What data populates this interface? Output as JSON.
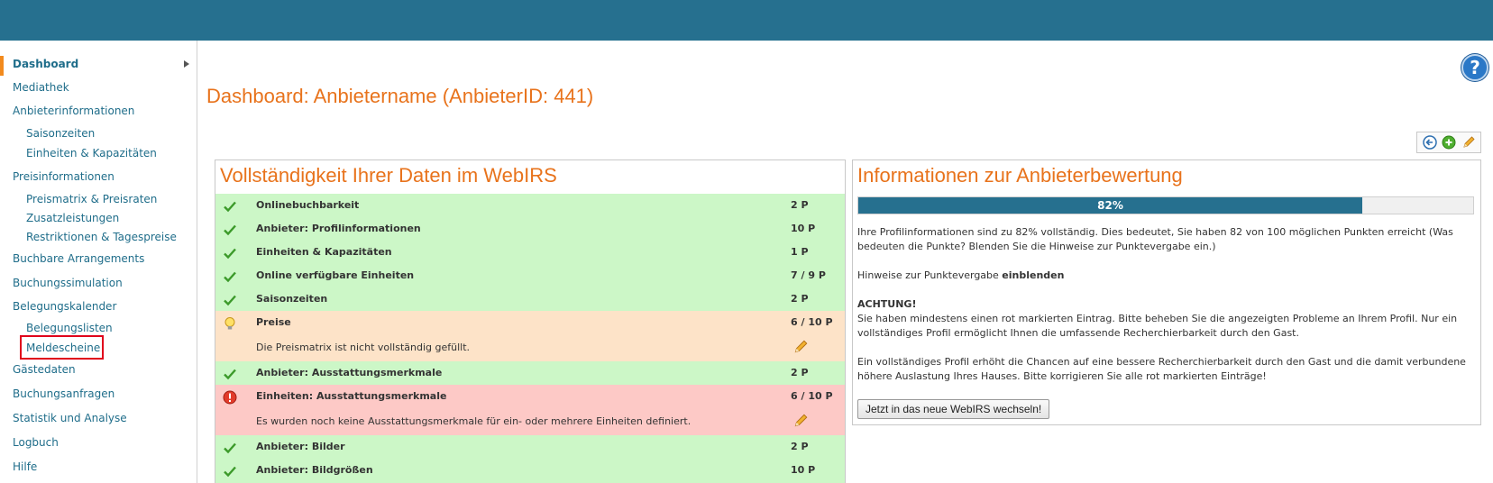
{
  "sidebar": {
    "items": [
      {
        "label": "Dashboard"
      },
      {
        "label": "Mediathek"
      },
      {
        "label": "Anbieterinformationen"
      },
      {
        "label": "Saisonzeiten"
      },
      {
        "label": "Einheiten & Kapazitäten"
      },
      {
        "label": "Preisinformationen"
      },
      {
        "label": "Preismatrix & Preisraten"
      },
      {
        "label": "Zusatzleistungen"
      },
      {
        "label": "Restriktionen & Tagespreise"
      },
      {
        "label": "Buchbare Arrangements"
      },
      {
        "label": "Buchungssimulation"
      },
      {
        "label": "Belegungskalender"
      },
      {
        "label": "Belegungslisten"
      },
      {
        "label": "Meldescheine"
      },
      {
        "label": "Gästedaten"
      },
      {
        "label": "Buchungsanfragen"
      },
      {
        "label": "Statistik und Analyse"
      },
      {
        "label": "Logbuch"
      },
      {
        "label": "Hilfe"
      }
    ]
  },
  "help": {
    "label": "?"
  },
  "page": {
    "title": "Dashboard: Anbietername (AnbieterID: 441)"
  },
  "completeness": {
    "title": "Vollständigkeit Ihrer Daten im WebIRS",
    "rows": [
      {
        "label": "Onlinebuchbarkeit",
        "points": "2 P",
        "status": "ok"
      },
      {
        "label": "Anbieter: Profilinformationen",
        "points": "10 P",
        "status": "ok"
      },
      {
        "label": "Einheiten & Kapazitäten",
        "points": "1 P",
        "status": "ok"
      },
      {
        "label": "Online verfügbare Einheiten",
        "points": "7 / 9 P",
        "status": "ok"
      },
      {
        "label": "Saisonzeiten",
        "points": "2 P",
        "status": "ok"
      },
      {
        "label": "Preise",
        "points": "6 / 10 P",
        "status": "warn",
        "note": "Die Preismatrix ist nicht vollständig gefüllt."
      },
      {
        "label": "Anbieter: Ausstattungsmerkmale",
        "points": "2 P",
        "status": "ok"
      },
      {
        "label": "Einheiten: Ausstattungsmerkmale",
        "points": "6 / 10 P",
        "status": "err",
        "note": "Es wurden noch keine Ausstattungsmerkmale für ein- oder mehrere Einheiten definiert."
      },
      {
        "label": "Anbieter: Bilder",
        "points": "2 P",
        "status": "ok"
      },
      {
        "label": "Anbieter: Bildgrößen",
        "points": "10 P",
        "status": "ok"
      }
    ]
  },
  "rating": {
    "title": "Informationen zur Anbieterbewertung",
    "progress_label": "82%",
    "progress_value": 0.82,
    "intro": "Ihre Profilinformationen sind zu 82% vollständig. Dies bedeutet, Sie haben 82 von 100 möglichen Punkten erreicht (Was bedeuten die Punkte? Blenden Sie die Hinweise zur Punktevergabe ein.)",
    "hint_prefix": "Hinweise zur Punktevergabe ",
    "hint_link": "einblenden",
    "warning_heading": "ACHTUNG!",
    "warning_text": "Sie haben mindestens einen rot markierten Eintrag. Bitte beheben Sie die angezeigten Probleme an Ihrem Profil. Nur ein vollständiges Profil ermöglicht Ihnen die umfassende Recherchierbarkeit durch den Gast.",
    "closing_text": "Ein vollständiges Profil erhöht die Chancen auf eine bessere Recherchierbarkeit durch den Gast und die damit verbundene höhere Auslastung Ihres Hauses. Bitte korrigieren Sie alle rot markierten Einträge!",
    "switch_button": "Jetzt in das neue WebIRS wechseln!"
  },
  "colors": {
    "brand": "#26708f",
    "accent": "#e8731c",
    "ok": "#ccf7c7",
    "warn": "#fde3c8",
    "err": "#fdc9c6"
  },
  "icons": {
    "ok": "checkmark-icon",
    "warn": "lightbulb-icon",
    "err": "exclamation-icon",
    "edit": "pencil-icon",
    "back": "back-arrow-icon",
    "add": "plus-icon"
  }
}
